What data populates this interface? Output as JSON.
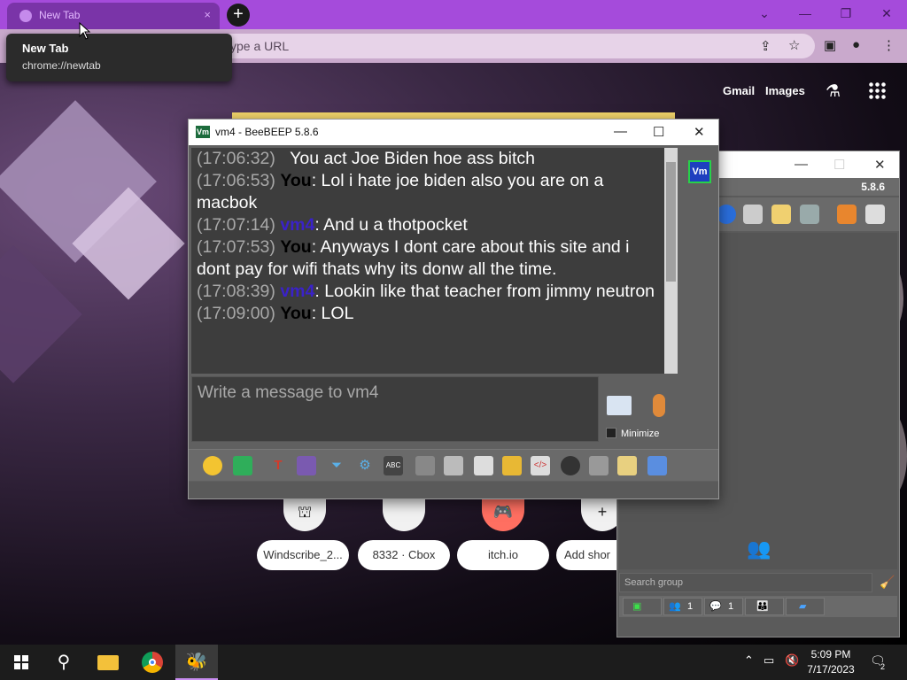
{
  "browser": {
    "tab_title": "New Tab",
    "tab_close": "×",
    "new_tab": "+",
    "window_controls": {
      "tabsearch": "⌄",
      "minimize": "—",
      "restore": "❐",
      "close": "✕"
    },
    "omnibox_placeholder": "ype a URL",
    "tooltip": {
      "title": "New Tab",
      "url": "chrome://newtab"
    },
    "links": {
      "gmail": "Gmail",
      "images": "Images"
    },
    "shortcuts": [
      {
        "label": "Windscribe_2...",
        "glyph": "⛫"
      },
      {
        "label": "8332 · Cbox",
        "glyph": ""
      },
      {
        "label": "itch.io",
        "glyph": "🎮"
      },
      {
        "label": "Add shor",
        "glyph": "+"
      }
    ]
  },
  "beebeep_main": {
    "version": "5.8.6",
    "search_placeholder": "Search group",
    "status": [
      {
        "icon": "▣",
        "count": ""
      },
      {
        "icon": "👥",
        "count": "1"
      },
      {
        "icon": "💬",
        "count": "1"
      },
      {
        "icon": "👪",
        "count": ""
      },
      {
        "icon": "▰",
        "count": ""
      }
    ]
  },
  "chat": {
    "title": "vm4 - BeeBEEP 5.8.6",
    "app_icon_label": "Vm",
    "controls": {
      "minimize": "—",
      "maximize": "☐",
      "close": "✕"
    },
    "avatar_label": "Vm",
    "messages": [
      {
        "time": "(17:06:32)",
        "sender": "",
        "text": "You act Joe Biden hoe ass bitch"
      },
      {
        "time": "(17:06:53)",
        "sender": "You",
        "text": ": Lol i hate joe biden also you are on a macbok"
      },
      {
        "time": "(17:07:14)",
        "sender": "vm4",
        "text": ": And u a thotpocket"
      },
      {
        "time": "(17:07:53)",
        "sender": "You",
        "text": ": Anyways I dont care about this site and i dont pay for wifi thats why its donw all the time."
      },
      {
        "time": "(17:08:39)",
        "sender": "vm4",
        "text": ": Lookin like that teacher from jimmy neutron"
      },
      {
        "time": "(17:09:00)",
        "sender": "You",
        "text": ": LOL"
      }
    ],
    "input_placeholder": "Write a message to vm4",
    "minimize_label": "Minimize"
  },
  "taskbar": {
    "time": "5:09 PM",
    "date": "7/17/2023",
    "notifications": "2"
  }
}
